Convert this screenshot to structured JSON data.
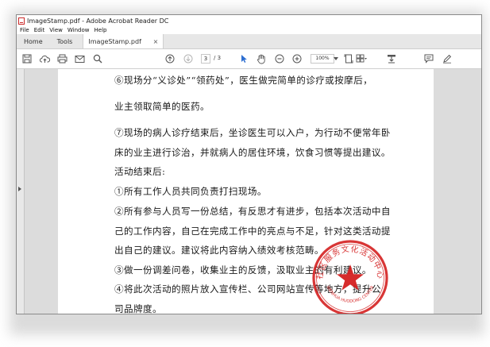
{
  "window": {
    "title": "ImageStamp.pdf - Adobe Acrobat Reader DC"
  },
  "menu": [
    "File",
    "Edit",
    "View",
    "Window",
    "Help"
  ],
  "tabs": {
    "home": "Home",
    "tools": "Tools",
    "document": "ImageStamp.pdf",
    "close": "×"
  },
  "toolbar": {
    "icons": [
      "save-icon",
      "upload-icon",
      "print-icon",
      "email-icon",
      "search-icon",
      "page-up-icon",
      "page-down-icon",
      "select-cursor-icon",
      "hand-icon",
      "zoom-out-icon",
      "zoom-in-icon",
      "zoom-dropdown-icon",
      "fit-page-icon",
      "scroll-mode-icon",
      "stamp-tool-icon",
      "comment-icon",
      "pen-icon"
    ],
    "page_current": "3",
    "page_total": "/ 3",
    "zoom": "100%",
    "accent_color": "#2e6fd1"
  },
  "document": {
    "lines": [
      "⑥现场分“义诊处”“领药处”，医生做完简单的诊疗或按摩后，",
      "业主领取简单的医药。",
      "⑦现场的病人诊疗结束后，坐诊医生可以入户，为行动不便常年卧",
      "床的业主进行诊治，并就病人的居住环境，饮食习惯等提出建议。",
      "活动结束后:",
      "①所有工作人员共同负责打扫现场。",
      "②所有参与人员写一份总结，有反思才有进步，包括本次活动中自",
      "己的工作内容，自己在完成工作中的亮点与不足，针对这类活动提",
      "出自己的建议。建议将此内容纳入绩效考核范畴。",
      "③做一份调差问卷，收集业主的反馈，汲取业主的有利建议。",
      "④将此次活动的照片放入宣传栏、公司网站宣传等地方，提升公",
      "司品牌度。"
    ],
    "stamp": {
      "text_cn": "社区服务文化活动中心",
      "text_en": "WENHUA HUODONG CENTER",
      "color": "#d42020"
    }
  }
}
